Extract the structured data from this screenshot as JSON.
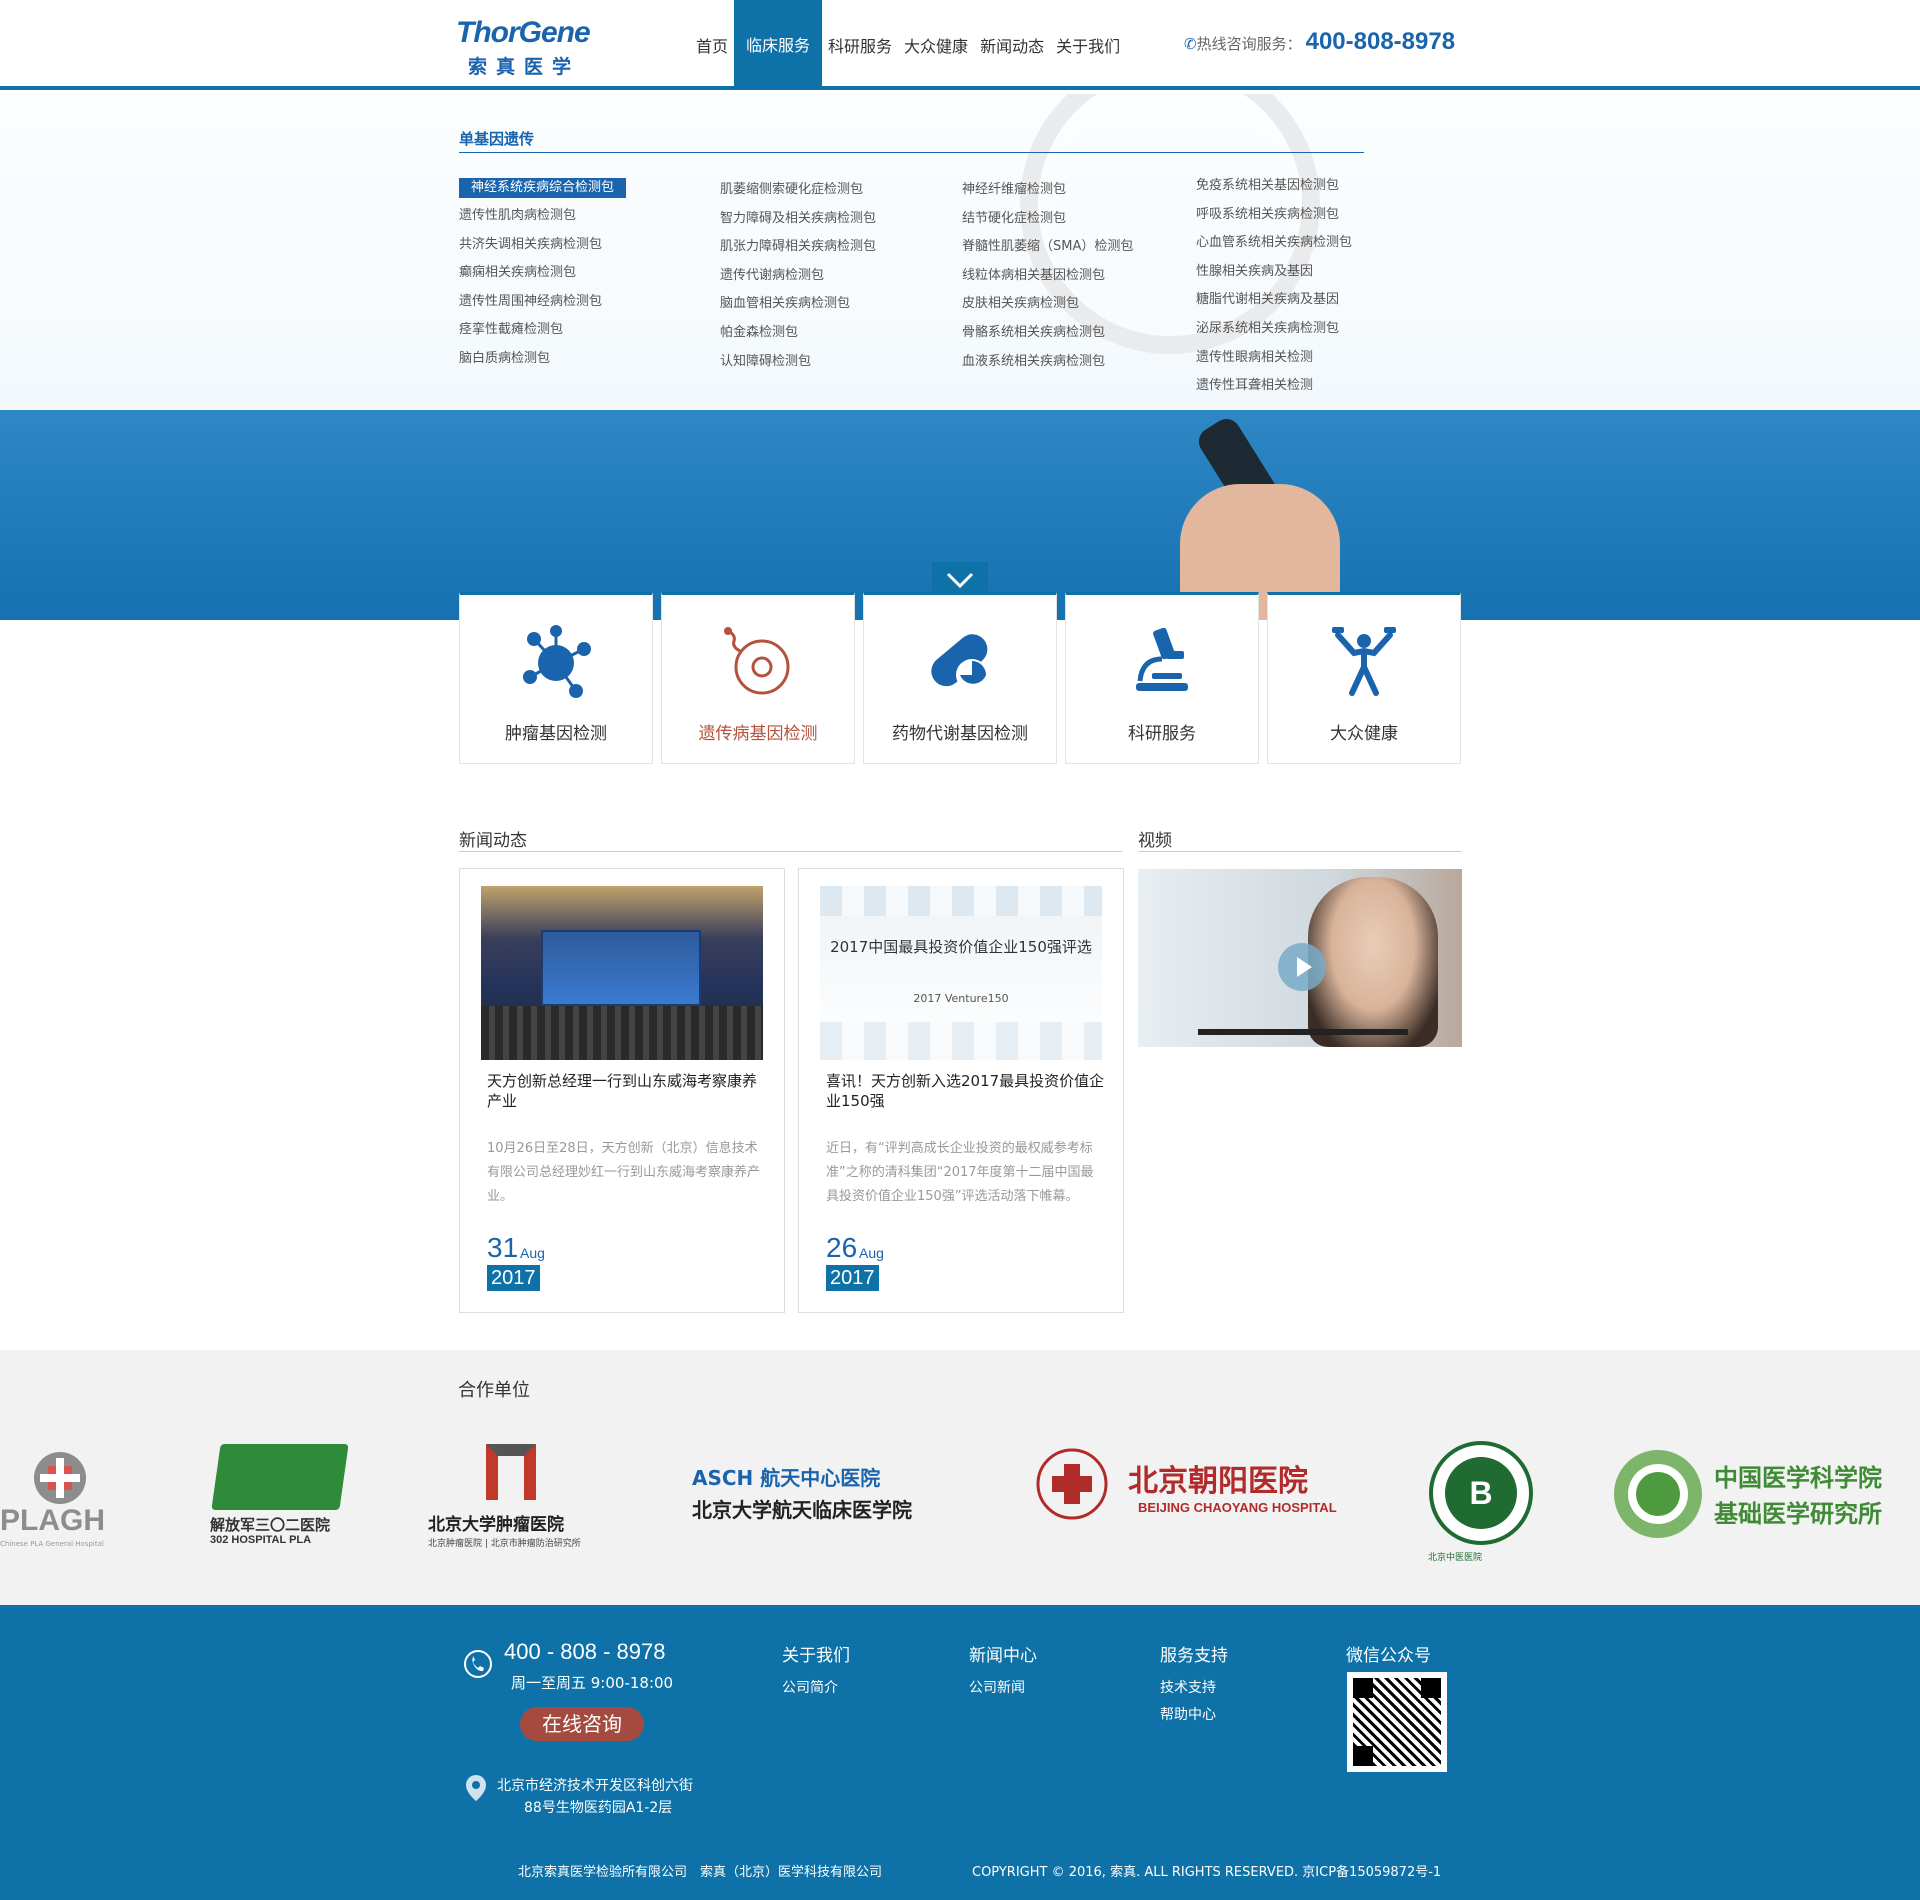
{
  "brand": {
    "name_en": "ThorGene",
    "name_cn": "索真医学",
    "accent": "#0e72a8",
    "accent_dark": "#1a64ad"
  },
  "nav": {
    "items": [
      "首页",
      "临床服务",
      "科研服务",
      "大众健康",
      "新闻动态",
      "关于我们"
    ],
    "active": "临床服务",
    "hotline_label": "热线咨询服务：",
    "hotline_number": "400-808-8978",
    "hotline_icon": "phone-icon"
  },
  "dropdown": {
    "title": "单基因遗传",
    "col1": [
      "神经系统疾病综合检测包",
      "遗传性肌肉病检测包",
      "共济失调相关疾病检测包",
      "癫痫相关疾病检测包",
      "遗传性周围神经病检测包",
      "痉挛性截瘫检测包",
      "脑白质病检测包"
    ],
    "col2": [
      "肌萎缩侧索硬化症检测包",
      "智力障碍及相关疾病检测包",
      "肌张力障碍相关疾病检测包",
      "遗传代谢病检测包",
      "脑血管相关疾病检测包",
      "帕金森检测包",
      "认知障碍检测包"
    ],
    "col3": [
      "神经纤维瘤检测包",
      "结节硬化症检测包",
      "脊髓性肌萎缩（SMA）检测包",
      "线粒体病相关基因检测包",
      "皮肤相关疾病检测包",
      "骨骼系统相关疾病检测包",
      "血液系统相关疾病检测包"
    ],
    "col4": [
      "免疫系统相关基因检测包",
      "呼吸系统相关疾病检测包",
      "心血管系统相关疾病检测包",
      "性腺相关疾病及基因",
      "糖脂代谢相关疾病及基因",
      "泌尿系统相关疾病检测包",
      "遗传性眼病相关检测",
      "遗传性耳聋相关检测"
    ]
  },
  "services": [
    {
      "label": "肿瘤基因检测",
      "icon": "molecule-icon"
    },
    {
      "label": "遗传病基因检测",
      "icon": "cell-icon"
    },
    {
      "label": "药物代谢基因检测",
      "icon": "pill-icon"
    },
    {
      "label": "科研服务",
      "icon": "microscope-icon"
    },
    {
      "label": "大众健康",
      "icon": "fitness-icon"
    }
  ],
  "news": {
    "title": "新闻动态",
    "items": [
      {
        "title": "天方创新总经理一行到山东威海考察康养产业",
        "desc": "10月26日至28日，天方创新（北京）信息技术有限公司总经理妙红一行到山东威海考察康养产业。",
        "day": "31",
        "month": "Aug",
        "year": "2017"
      },
      {
        "title": "喜讯！天方创新入选2017最具投资价值企业150强",
        "desc": "近日，有“评判高成长企业投资的最权威参考标准”之称的清科集团“2017年度第十二届中国最具投资价值企业150强”评选活动落下帷幕。",
        "day": "26",
        "month": "Aug",
        "year": "2017",
        "thumb_title": "2017中国最具投资价值企业150强评选",
        "thumb_sub": "2017 Venture150"
      }
    ]
  },
  "video": {
    "title": "视频"
  },
  "partners": {
    "title": "合作单位",
    "items": [
      {
        "name": "PLAGH",
        "sub": "Chinese PLA General Hospital"
      },
      {
        "name": "解放军三〇二医院",
        "sub": "302 HOSPITAL PLA"
      },
      {
        "name": "北京大学肿瘤医院",
        "sub": "北京肿瘤医院 | 北京市肿瘤防治研究所"
      },
      {
        "name": "ASCH 航天中心医院",
        "sub": "北京大学航天临床医学院"
      },
      {
        "name": "北京朝阳医院",
        "sub": "BEIJING CHAOYANG HOSPITAL"
      },
      {
        "name": "北京中医医院",
        "sub": ""
      },
      {
        "name": "中国医学科学院",
        "sub": "基础医学研究所"
      }
    ]
  },
  "footer": {
    "phone": "400 - 808 - 8978",
    "hours": "周一至周五 9:00-18:00",
    "consult": "在线咨询",
    "address_line1": "北京市经济技术开发区科创六街",
    "address_line2": "88号生物医药园A1-2层",
    "cols": [
      {
        "heading": "关于我们",
        "links": [
          "公司简介"
        ]
      },
      {
        "heading": "新闻中心",
        "links": [
          "公司新闻"
        ]
      },
      {
        "heading": "服务支持",
        "links": [
          "技术支持",
          "帮助中心"
        ]
      }
    ],
    "wechat_title": "微信公众号",
    "company_names": "北京索真医学检验所有限公司　索真（北京）医学科技有限公司",
    "copyright": "COPYRIGHT © 2016, 索真. ALL RIGHTS RESERVED. 京ICP备15059872号-1"
  }
}
